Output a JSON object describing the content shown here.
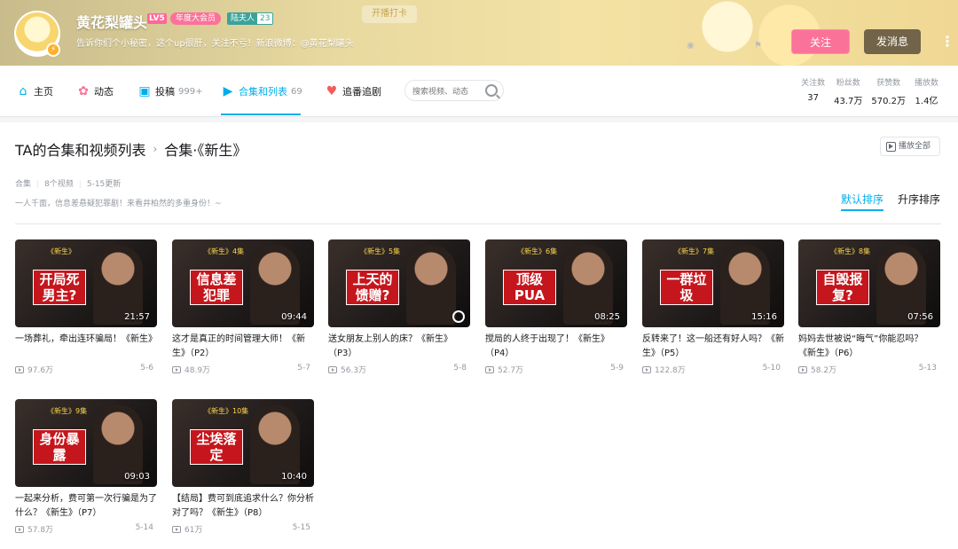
{
  "header": {
    "banner_sign": "开播打卡",
    "username": "黄花梨罐头",
    "level": "LV5",
    "vip_badge": "年度大会员",
    "medal_name": "陆夫人",
    "medal_level": "23",
    "signature": "告诉你们个小秘密，这个up很肝，关注不亏！新浪微博：@黄花梨罐头",
    "follow_label": "关注",
    "message_label": "发消息",
    "more_label": "⋮"
  },
  "nav": {
    "items": [
      {
        "label": "主页",
        "icon": "home-icon",
        "count": ""
      },
      {
        "label": "动态",
        "icon": "dynamic-icon",
        "count": ""
      },
      {
        "label": "投稿",
        "icon": "upload-icon",
        "count": "999+"
      },
      {
        "label": "合集和列表",
        "icon": "collection-icon",
        "count": "69"
      },
      {
        "label": "追番追剧",
        "icon": "heart-icon",
        "count": ""
      }
    ],
    "search_placeholder": "搜索视频、动态",
    "stats": [
      {
        "label": "关注数",
        "value": "37"
      },
      {
        "label": "粉丝数",
        "value": "43.7万"
      },
      {
        "label": "获赞数",
        "value": "570.2万"
      },
      {
        "label": "播放数",
        "value": "1.4亿"
      }
    ]
  },
  "collection": {
    "breadcrumb_root": "TA的合集和视频列表",
    "breadcrumb_sep": "›",
    "name": "合集·《新生》",
    "play_all_label": "播放全部",
    "type": "合集",
    "video_count": "8个视频",
    "updated": "5-15更新",
    "description": "一人千面，信息差悬疑犯罪剧！来看井柏然的多重身份！~",
    "sort_default": "默认排序",
    "sort_asc": "升序排序"
  },
  "videos": [
    {
      "ep": "《新生》",
      "caption": "开局死男主?",
      "duration": "21:57",
      "title": "一场葬礼，牵出连环骗局！《新生》",
      "views": "97.6万",
      "date": "5-6"
    },
    {
      "ep": "《新生》4集",
      "caption": "信息差犯罪",
      "duration": "09:44",
      "title": "这才是真正的时间管理大师！《新生》（P2）",
      "views": "48.9万",
      "date": "5-7"
    },
    {
      "ep": "《新生》5集",
      "caption": "上天的馈赠?",
      "duration": "",
      "title": "送女朋友上别人的床？《新生》（P3）",
      "views": "56.3万",
      "date": "5-8"
    },
    {
      "ep": "《新生》6集",
      "caption": "顶级PUA",
      "duration": "08:25",
      "title": "搅局的人终于出现了！《新生》（P4）",
      "views": "52.7万",
      "date": "5-9"
    },
    {
      "ep": "《新生》7集",
      "caption": "一群垃圾",
      "duration": "15:16",
      "title": "反转来了！这一船还有好人吗？《新生》（P5）",
      "views": "122.8万",
      "date": "5-10"
    },
    {
      "ep": "《新生》8集",
      "caption": "自毁报复?",
      "duration": "07:56",
      "title": "妈妈去世被说“晦气”你能忍吗？《新生》（P6）",
      "views": "58.2万",
      "date": "5-13"
    },
    {
      "ep": "《新生》9集",
      "caption": "身份暴露",
      "duration": "09:03",
      "title": "一起来分析，费可第一次行骗是为了什么？《新生》（P7）",
      "views": "57.8万",
      "date": "5-14"
    },
    {
      "ep": "《新生》10集",
      "caption": "尘埃落定",
      "duration": "10:40",
      "title": "【结局】费可到底追求什么？你分析对了吗？《新生》（P8）",
      "views": "61万",
      "date": "5-15"
    }
  ],
  "colors": {
    "accent": "#00aeec",
    "pink": "#fb7299",
    "caption_red": "#c4161c"
  }
}
